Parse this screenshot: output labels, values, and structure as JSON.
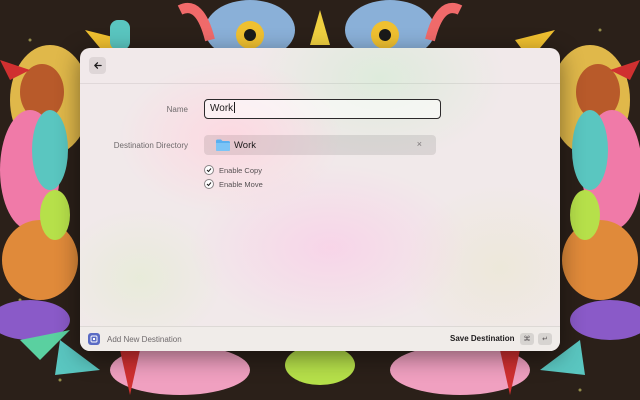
{
  "form": {
    "name_label": "Name",
    "name_value": "Work",
    "destination_label": "Destination Directory",
    "destination_value": "Work",
    "clear_glyph": "×",
    "checkboxes": [
      {
        "label": "Enable Copy",
        "checked": true
      },
      {
        "label": "Enable Move",
        "checked": true
      }
    ]
  },
  "footer": {
    "title": "Add New Destination",
    "primary_action": "Save Destination",
    "shortcut_keys": [
      "⌘",
      "↵"
    ]
  },
  "icons": {
    "back": "arrow-left-icon",
    "folder": "folder-icon",
    "clear": "close-icon",
    "check": "checkmark-icon",
    "app": "app-icon"
  },
  "colors": {
    "folder_blue": "#5ab0f0",
    "app_icon": "#5a6bc4",
    "input_border": "#2c2a2b"
  }
}
